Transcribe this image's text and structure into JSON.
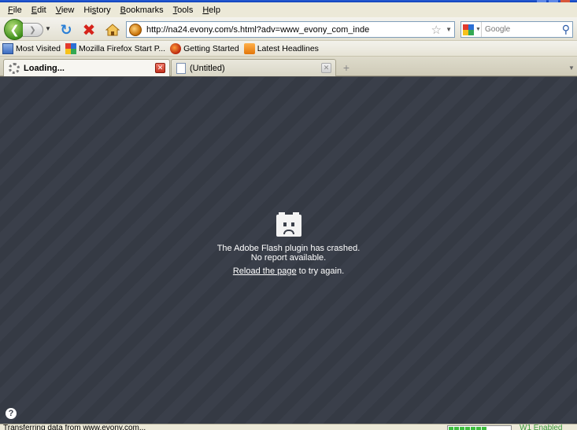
{
  "menu": {
    "items": [
      {
        "ul": "F",
        "rest": "ile"
      },
      {
        "ul": "E",
        "rest": "dit"
      },
      {
        "ul": "V",
        "rest": "iew"
      },
      {
        "pre": "Hi",
        "ul": "s",
        "rest": "tory"
      },
      {
        "ul": "B",
        "rest": "ookmarks"
      },
      {
        "ul": "T",
        "rest": "ools"
      },
      {
        "ul": "H",
        "rest": "elp"
      }
    ]
  },
  "navigation": {
    "back_icon": "back-arrow-icon",
    "forward_icon": "forward-arrow-icon",
    "url": "http://na24.evony.com/s.html?adv=www_evony_com_inde",
    "search_placeholder": "Google"
  },
  "bookmarks": [
    {
      "label": "Most Visited",
      "icon": "most-visited-icon"
    },
    {
      "label": "Mozilla Firefox Start P...",
      "icon": "google-icon"
    },
    {
      "label": "Getting Started",
      "icon": "firefox-icon"
    },
    {
      "label": "Latest Headlines",
      "icon": "rss-icon"
    }
  ],
  "tabs": [
    {
      "label": "Loading...",
      "active": true
    },
    {
      "label": "(Untitled)",
      "active": false
    }
  ],
  "content": {
    "crash_line1": "The Adobe Flash plugin has crashed.",
    "crash_line2": "No report available.",
    "reload_link": "Reload the page",
    "reload_suffix": " to try again.",
    "help_glyph": "?"
  },
  "status": {
    "text": "Transferring data from www.evony.com...",
    "progress_percent": 65,
    "right_text": "W1 Enabled"
  },
  "colors": {
    "content_bg": "#3a3f4a",
    "accent_green": "#3fbf3f",
    "stop_red": "#d6231b",
    "reload_blue": "#2a7fd6"
  }
}
